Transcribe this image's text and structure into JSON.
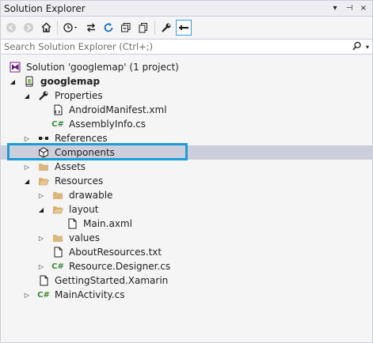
{
  "window": {
    "title": "Solution Explorer",
    "controls": {
      "dropdown": "▾",
      "pin": "⊣",
      "close": "×"
    }
  },
  "toolbar": {
    "buttons": [
      "back-icon",
      "forward-icon",
      "home-icon",
      "history-icon",
      "sync-icon",
      "refresh-icon",
      "collapse-all-icon",
      "show-all-files-icon",
      "properties-icon",
      "preview-icon"
    ]
  },
  "search": {
    "placeholder": "Search Solution Explorer (Ctrl+;)"
  },
  "tree": {
    "solution": "Solution 'googlemap' (1 project)",
    "project": "googlemap",
    "properties": "Properties",
    "android_manifest": "AndroidManifest.xml",
    "assembly_info": "AssemblyInfo.cs",
    "references": "References",
    "components": "Components",
    "assets": "Assets",
    "resources": "Resources",
    "drawable": "drawable",
    "layout": "layout",
    "main_axml": "Main.axml",
    "values": "values",
    "about_resources": "AboutResources.txt",
    "resource_designer": "Resource.Designer.cs",
    "getting_started": "GettingStarted.Xamarin",
    "main_activity": "MainActivity.cs"
  },
  "colors": {
    "selection": "#cccedb",
    "highlight": "#1a9cd8",
    "accent": "#3399ff",
    "csharp": "#388a34",
    "folder": "#dcb67a"
  }
}
